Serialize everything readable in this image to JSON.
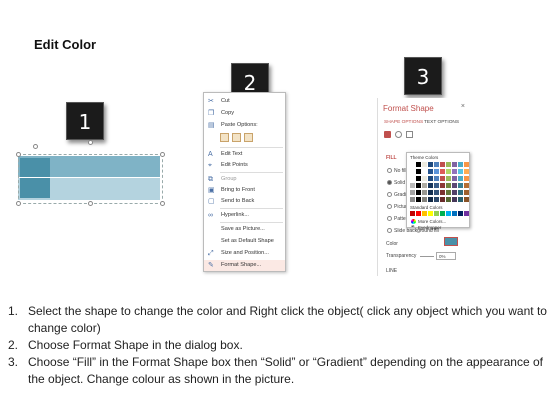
{
  "title": "Edit Color",
  "badges": [
    "1",
    "2",
    "3"
  ],
  "context_menu": {
    "items": [
      {
        "label": "Cut",
        "icon": "scissors-icon"
      },
      {
        "label": "Copy",
        "icon": "copy-icon"
      },
      {
        "label": "Paste Options:",
        "icon": "paste-icon"
      },
      {
        "label": "Edit Text",
        "icon": "edit-text-icon"
      },
      {
        "label": "Edit Points",
        "icon": "edit-points-icon"
      },
      {
        "label": "Group",
        "icon": "group-icon"
      },
      {
        "label": "Bring to Front",
        "icon": "bring-front-icon"
      },
      {
        "label": "Send to Back",
        "icon": "send-back-icon"
      },
      {
        "label": "Hyperlink...",
        "icon": "hyperlink-icon"
      },
      {
        "label": "Save as Picture...",
        "icon": ""
      },
      {
        "label": "Set as Default Shape",
        "icon": ""
      },
      {
        "label": "Size and Position...",
        "icon": "size-icon"
      },
      {
        "label": "Format Shape...",
        "icon": "format-shape-icon"
      }
    ]
  },
  "format_pane": {
    "title": "Format Shape",
    "tabs": [
      "SHAPE OPTIONS",
      "TEXT OPTIONS"
    ],
    "fill_label": "FILL",
    "options": [
      "No fill",
      "Solid fill",
      "Gradient fill",
      "Picture or texture fill",
      "Pattern fill",
      "Slide background fill"
    ],
    "color_label": "Color",
    "transparency_label": "Transparency",
    "transparency_value": "0%",
    "line_label": "LINE",
    "theme_colors_label": "Theme Colors",
    "standard_colors_label": "Standard Colors",
    "more_colors_label": "More Colors...",
    "eyedropper_label": "Eyedropper"
  },
  "instructions": [
    {
      "num": "1.",
      "text": "Select the shape to change the color and Right click the object( click any object which you want to change color)"
    },
    {
      "num": "2.",
      "text": "Choose Format Shape in the dialog box."
    },
    {
      "num": "3.",
      "text": "Choose “Fill” in the Format Shape box then “Solid” or “Gradient” depending on the appearance of the object. Change colour as shown in the picture."
    }
  ],
  "colors": {
    "bar_dark": "#4a90a8",
    "bar_mid": "#7fb3c6",
    "bar_light": "#b4d3df",
    "accent_red": "#c0504d"
  }
}
